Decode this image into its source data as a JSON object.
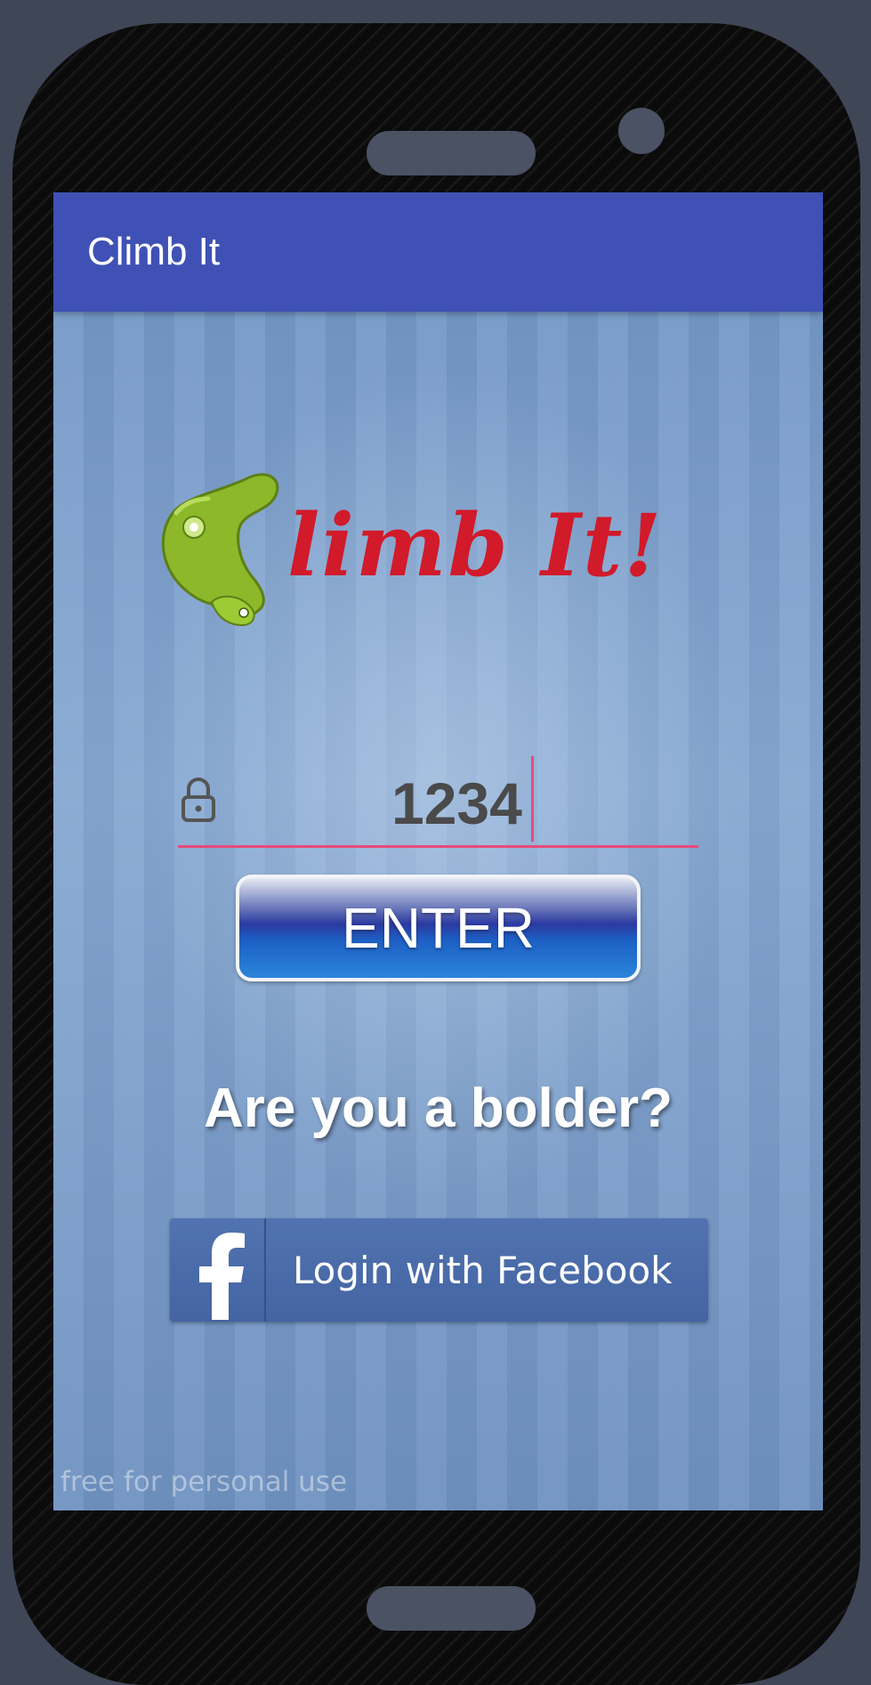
{
  "app": {
    "title": "Climb It"
  },
  "logo": {
    "text": "limb It!",
    "icon": "climbing-hold-icon"
  },
  "pin": {
    "icon": "lock-icon",
    "value": "1234"
  },
  "enter_button": {
    "label": "ENTER"
  },
  "prompt": {
    "text": "Are you a bolder?"
  },
  "facebook_button": {
    "icon": "facebook-icon",
    "label": "Login with Facebook"
  },
  "watermark": {
    "text": "free for personal use"
  },
  "colors": {
    "app_bar": "#3f51b5",
    "accent": "#e84a7a",
    "logo_text": "#d11a2a",
    "facebook": "#4464a2",
    "background": "#7c9fc9"
  }
}
